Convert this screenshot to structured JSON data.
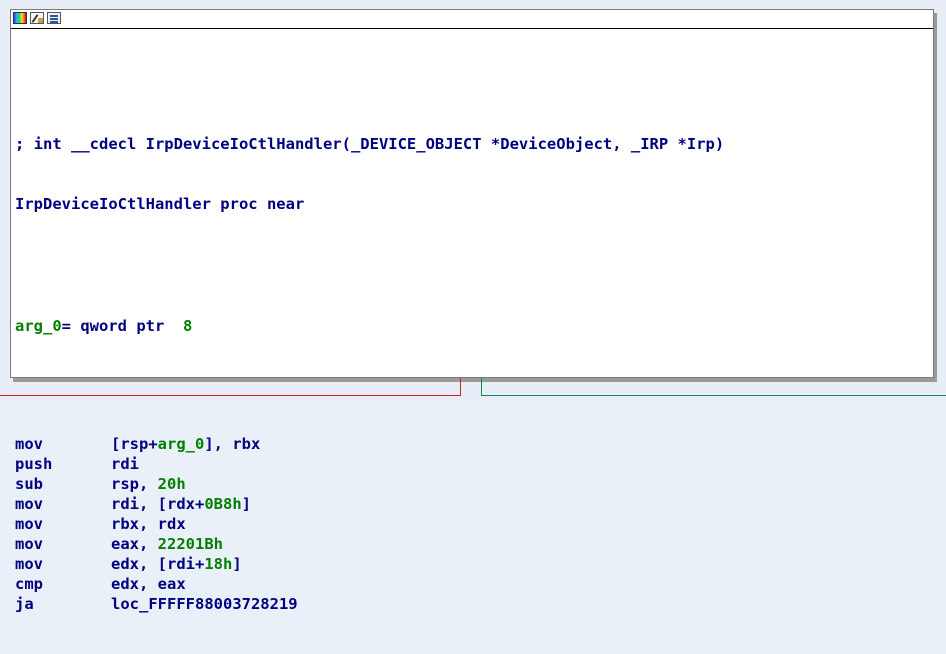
{
  "node": {
    "title_icons": [
      "color-icon",
      "rename-icon",
      "graph-icon"
    ],
    "comment_line": "; int __cdecl IrpDeviceIoCtlHandler(_DEVICE_OBJECT *DeviceObject, _IRP *Irp)",
    "proc_line": "IrpDeviceIoCtlHandler proc near",
    "arg_decl": {
      "name": "arg_0",
      "type": "= qword ptr",
      "offset": "8"
    },
    "instructions": [
      {
        "mnemonic": "mov",
        "parts": [
          {
            "t": "[rsp+"
          },
          {
            "t": "arg_0",
            "c": "green"
          },
          {
            "t": "], rbx"
          }
        ]
      },
      {
        "mnemonic": "push",
        "parts": [
          {
            "t": "rdi"
          }
        ]
      },
      {
        "mnemonic": "sub",
        "parts": [
          {
            "t": "rsp, "
          },
          {
            "t": "20h",
            "c": "green"
          }
        ]
      },
      {
        "mnemonic": "mov",
        "parts": [
          {
            "t": "rdi, [rdx+"
          },
          {
            "t": "0B8h",
            "c": "green"
          },
          {
            "t": "]"
          }
        ]
      },
      {
        "mnemonic": "mov",
        "parts": [
          {
            "t": "rbx, rdx"
          }
        ]
      },
      {
        "mnemonic": "mov",
        "parts": [
          {
            "t": "eax, "
          },
          {
            "t": "22201Bh",
            "c": "green"
          }
        ]
      },
      {
        "mnemonic": "mov",
        "parts": [
          {
            "t": "edx, [rdi+"
          },
          {
            "t": "18h",
            "c": "green"
          },
          {
            "t": "]"
          }
        ]
      },
      {
        "mnemonic": "cmp",
        "parts": [
          {
            "t": "edx, eax"
          }
        ]
      },
      {
        "mnemonic": "ja",
        "parts": [
          {
            "t": "loc_FFFFF88003728219"
          }
        ]
      }
    ]
  },
  "colors": {
    "code": "#000080",
    "number": "#008000",
    "edge_false": "#d02020",
    "edge_true": "#208040"
  }
}
